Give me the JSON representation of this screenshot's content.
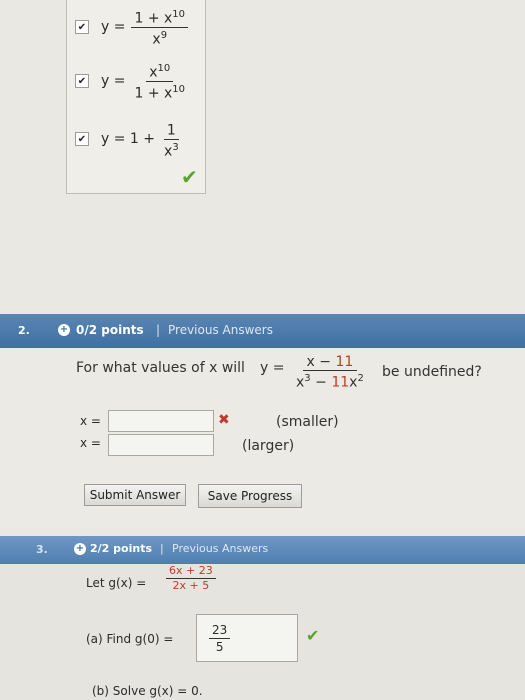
{
  "q1": {
    "options": [
      {
        "lhs": "y =",
        "num": "1 + x",
        "num_sup": "10",
        "den": "x",
        "den_sup": "9",
        "checked": true
      },
      {
        "lhs": "y =",
        "num": "x",
        "num_sup": "10",
        "den": "1 + x",
        "den_sup": "10",
        "checked": true
      },
      {
        "lhs": "y = 1 +",
        "num": "1",
        "num_sup": "",
        "den": "x",
        "den_sup": "3",
        "checked": true
      }
    ],
    "correct_mark": "✔"
  },
  "q2": {
    "number": "2.",
    "points": "0/2 points",
    "separator": "|",
    "previous_answers": "Previous Answers",
    "question_prefix": "For what values of x will",
    "y_eq": "y =",
    "fn_num": "x − ",
    "fn_num_red": "11",
    "fn_den": "x",
    "fn_den_sup1": "3",
    "fn_den_mid": " − ",
    "fn_den_red": "11",
    "fn_den_x": "x",
    "fn_den_sup2": "2",
    "question_suffix": "be undefined?",
    "answers": [
      {
        "label": "x =",
        "value": "",
        "status": "✖",
        "hint": "(smaller)"
      },
      {
        "label": "x =",
        "value": "",
        "status": "",
        "hint": "(larger)"
      }
    ],
    "submit_label": "Submit Answer",
    "save_label": "Save Progress"
  },
  "q3": {
    "number": "3.",
    "points": "2/2 points",
    "separator": "|",
    "previous_answers": "Previous Answers",
    "let_text": "Let g(x) =",
    "g_num_red": "6x + 23",
    "g_den_red": "2x + 5",
    "part_a_label": "(a) Find g(0) =",
    "part_a_num": "23",
    "part_a_den": "5",
    "part_a_status": "✔",
    "part_b_label": "(b) Solve g(x) = 0."
  }
}
